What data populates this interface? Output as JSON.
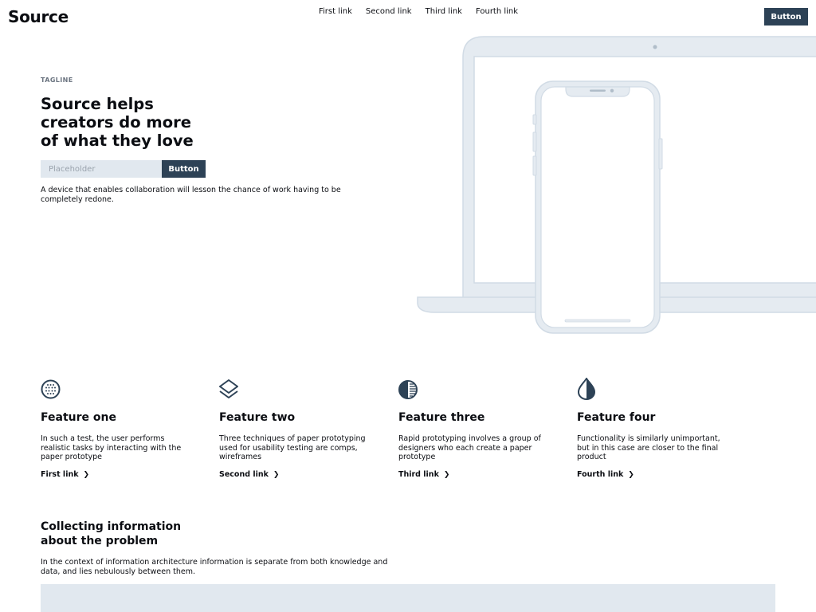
{
  "header": {
    "logo": "Source",
    "nav": [
      "First link",
      "Second link",
      "Third link",
      "Fourth link"
    ],
    "button": "Button"
  },
  "hero": {
    "tagline": "TAGLINE",
    "title": "Source helps creators do more of what they love",
    "input_placeholder": "Placeholder",
    "button": "Button",
    "description": "A device that enables collaboration will lesson the chance of work having to be completely redone."
  },
  "features": [
    {
      "icon": "grid-globe-icon",
      "title": "Feature one",
      "text": "In such a test, the user performs realistic tasks by interacting with the paper prototype",
      "link": "First link"
    },
    {
      "icon": "layers-icon",
      "title": "Feature two",
      "text": "Three techniques of paper prototyping used for usability testing are comps, wireframes",
      "link": "Second link"
    },
    {
      "icon": "half-circle-icon",
      "title": "Feature three",
      "text": "Rapid prototyping involves a group of designers who each create a paper prototype",
      "link": "Third link"
    },
    {
      "icon": "drop-icon",
      "title": "Feature four",
      "text": "Functionality is similarly unimportant, but in this case are closer to the final product",
      "link": "Fourth link"
    }
  ],
  "section": {
    "title": "Collecting information about the problem",
    "description": "In the context of information architecture information is separate from both knowledge and data, and lies nebulously between them."
  },
  "colors": {
    "accent": "#2d4256",
    "light": "#e1e8ef",
    "device_stroke": "#d7e1ea"
  }
}
